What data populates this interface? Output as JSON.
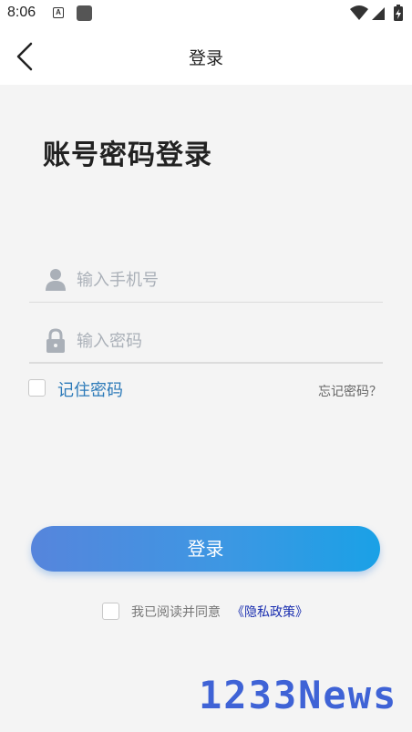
{
  "status_bar": {
    "time": "8:06",
    "app_icon_letter": "A"
  },
  "header": {
    "title": "登录"
  },
  "heading": "账号密码登录",
  "form": {
    "phone_placeholder": "输入手机号",
    "password_placeholder": "输入密码",
    "remember_label": "记住密码",
    "forgot_label": "忘记密码？",
    "login_button": "登录"
  },
  "agreement": {
    "text": "我已阅读并同意",
    "link": "《隐私政策》"
  },
  "watermark": "1233News",
  "colors": {
    "accent": "#2c7ab9",
    "button_start": "#5685dc",
    "button_end": "#1aa1e6",
    "link": "#1b2fb0",
    "background": "#f4f4f4"
  }
}
